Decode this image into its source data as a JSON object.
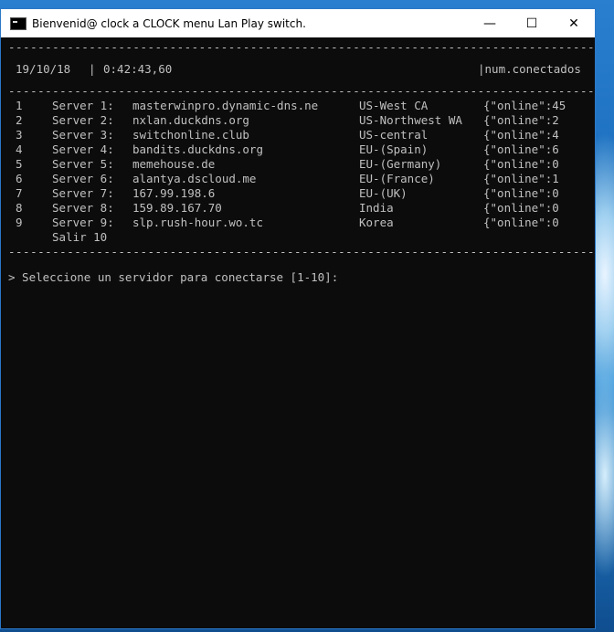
{
  "window": {
    "title": "Bienvenid@ clock a CLOCK menu Lan Play switch.",
    "minimize_glyph": "—",
    "maximize_glyph": "☐",
    "close_glyph": "✕",
    "app_icon": "console-icon"
  },
  "header": {
    "date": "19/10/18",
    "separator": "|",
    "time": "0:42:43,60",
    "right_label": "|num.conectados"
  },
  "servers": [
    {
      "num": "1",
      "label": "Server 1:",
      "host": "masterwinpro.dynamic-dns.ne",
      "region": "US-West CA",
      "online": "{\"online\":45"
    },
    {
      "num": "2",
      "label": "Server 2:",
      "host": "nxlan.duckdns.org",
      "region": "US-Northwest WA",
      "online": "{\"online\":2"
    },
    {
      "num": "3",
      "label": "Server 3:",
      "host": "switchonline.club",
      "region": "US-central",
      "online": "{\"online\":4"
    },
    {
      "num": "4",
      "label": "Server 4:",
      "host": "bandits.duckdns.org",
      "region": "EU-(Spain)",
      "online": "{\"online\":6"
    },
    {
      "num": "5",
      "label": "Server 5:",
      "host": "memehouse.de",
      "region": "EU-(Germany)",
      "online": "{\"online\":0"
    },
    {
      "num": "6",
      "label": "Server 6:",
      "host": "alantya.dscloud.me",
      "region": "EU-(France)",
      "online": "{\"online\":1"
    },
    {
      "num": "7",
      "label": "Server 7:",
      "host": "167.99.198.6",
      "region": "EU-(UK)",
      "online": "{\"online\":0"
    },
    {
      "num": "8",
      "label": "Server 8:",
      "host": "159.89.167.70",
      "region": "India",
      "online": "{\"online\":0"
    },
    {
      "num": "9",
      "label": "Server 9:",
      "host": "slp.rush-hour.wo.tc",
      "region": "Korea",
      "online": "{\"online\":0"
    }
  ],
  "exit_option": "Salir  10",
  "prompt": "> Seleccione un servidor para conectarse [1-10]:"
}
